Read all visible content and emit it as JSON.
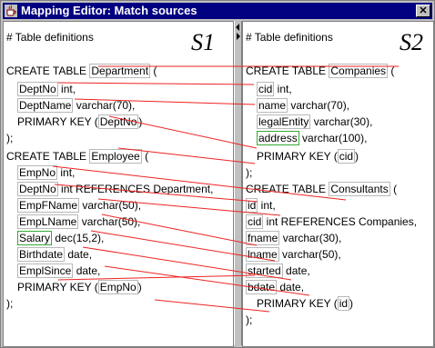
{
  "window": {
    "title": "Mapping Editor: Match sources",
    "close_glyph": "✕"
  },
  "left": {
    "comment": "# Table definitions",
    "schema_label": "S1",
    "lines": [
      {
        "pre": "CREATE TABLE ",
        "word": "Department",
        "post": " ("
      },
      {
        "pre": "",
        "word": "DeptNo",
        "post": " int,"
      },
      {
        "pre": "",
        "word": "DeptName",
        "post": " varchar(70),"
      },
      {
        "pre": "PRIMARY KEY (",
        "word": "DeptNo",
        "post": ")"
      },
      {
        "pre": "",
        "word": "",
        "post": ");"
      },
      {
        "pre": "CREATE TABLE ",
        "word": "Employee",
        "post": " ("
      },
      {
        "pre": "",
        "word": "EmpNo",
        "post": " int,"
      },
      {
        "pre": "",
        "word": "DeptNo",
        "post": " int REFERENCES Department,"
      },
      {
        "pre": "",
        "word": "EmpFName",
        "post": " varchar(50),"
      },
      {
        "pre": "",
        "word": "EmpLName",
        "post": " varchar(50),"
      },
      {
        "pre": "",
        "word": "Salary",
        "post": " dec(15,2),"
      },
      {
        "pre": "",
        "word": "Birthdate",
        "post": " date,"
      },
      {
        "pre": "",
        "word": "EmplSince",
        "post": " date,"
      },
      {
        "pre": "PRIMARY KEY (",
        "word": "EmpNo",
        "post": ")"
      },
      {
        "pre": "",
        "word": "",
        "post": ");"
      }
    ]
  },
  "right": {
    "comment": "# Table definitions",
    "schema_label": "S2",
    "lines": [
      {
        "pre": "CREATE TABLE ",
        "word": "Companies",
        "post": " ("
      },
      {
        "pre": "",
        "word": "cid",
        "post": " int,"
      },
      {
        "pre": "",
        "word": "name",
        "post": " varchar(70),"
      },
      {
        "pre": "",
        "word": "legalEntity",
        "post": " varchar(30),"
      },
      {
        "pre": "",
        "word": "address",
        "post": " varchar(100),"
      },
      {
        "pre": "PRIMARY KEY (",
        "word": "cid",
        "post": ")"
      },
      {
        "pre": "",
        "word": "",
        "post": ");"
      },
      {
        "pre": "CREATE TABLE ",
        "word": "Consultants",
        "post": " ("
      },
      {
        "pre": "",
        "word": "id",
        "post": " int,"
      },
      {
        "pre": "",
        "word": "cid",
        "post": " int REFERENCES Companies,"
      },
      {
        "pre": "",
        "word": "fname",
        "post": " varchar(30),"
      },
      {
        "pre": "",
        "word": "lname",
        "post": " varchar(50),"
      },
      {
        "pre": "",
        "word": "started",
        "post": " date,"
      },
      {
        "pre": "",
        "word": "bdate",
        "post": " date,"
      },
      {
        "pre": "PRIMARY KEY (",
        "word": "id",
        "post": ")"
      },
      {
        "pre": "",
        "word": "",
        "post": ");"
      }
    ]
  },
  "colors": {
    "match_line": "#ee2222",
    "selected_box": "#33aa33",
    "titlebar": "#000080"
  }
}
